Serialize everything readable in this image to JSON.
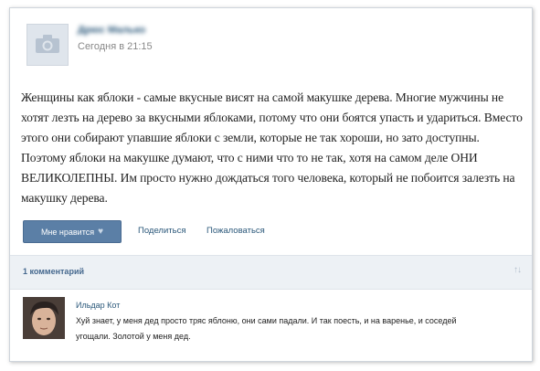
{
  "post": {
    "author": "Дрюс Малько",
    "timestamp": "Сегодня в 21:15",
    "text": "Женщины как яблоки - самые вкусные висят на самой макушке дерева. Многие мужчины не хотят лезть на дерево за вкусными яблоками, потому что они боятся упасть и удариться. Вместо этого они собирают упавшие яблоки с земли, которые не так хороши, но зато доступны. Поэтому яблоки на макушке думают, что с ними что то не так, хотя на самом деле ОНИ ВЕЛИКОЛЕПНЫ. Им просто нужно дождаться того человека, который не побоится залезть на макушку дерева.",
    "avatar_icon": "camera-icon"
  },
  "actions": {
    "like_label": "Мне нравится",
    "like_icon": "heart-icon",
    "share_label": "Поделиться",
    "report_label": "Пожаловаться"
  },
  "comments": {
    "count_label": "1 комментарий",
    "sort_icon": "sort-arrows-icon",
    "items": [
      {
        "author": "Ильдар Кот",
        "text": "Хуй знает, у меня дед просто тряс яблоню, они сами падали. И так поесть, и на варенье, и соседей угощали. Золотой у меня дед."
      }
    ]
  },
  "colors": {
    "link": "#2b587a",
    "button": "#5b7fa6",
    "comments_bar": "#edf1f5"
  }
}
